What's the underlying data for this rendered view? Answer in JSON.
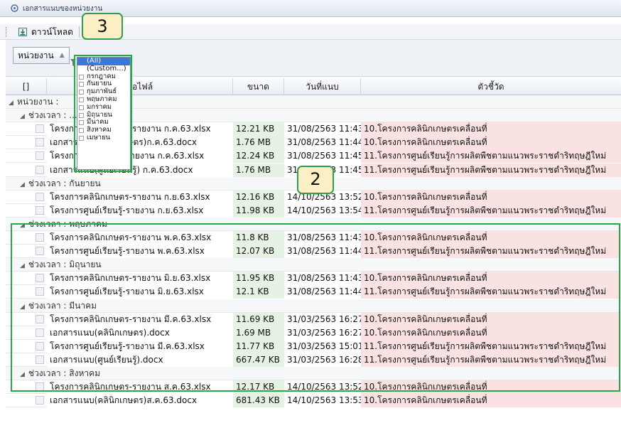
{
  "window": {
    "title": "เอกสารแนบของหน่วยงาน"
  },
  "toolbar": {
    "download_label": "ดาวน์โหลด"
  },
  "group_panel": {
    "chip_label": "หน่วยงาน"
  },
  "grid": {
    "columns": {
      "select": "[]",
      "file_name": "ชื่อไฟล์",
      "size": "ขนาด",
      "date": "วันที่แนบ",
      "indicator": "ตัวชี้วัด"
    },
    "org_group_label": "หน่วยงาน : ",
    "rows": [
      {
        "kind": "group",
        "label": "ช่วงเวลา : ..."
      },
      {
        "kind": "data",
        "name": "โครงการคลินิกเกษตร-รายงาน ก.ค.63.xlsx",
        "size": "12.21 KB",
        "date": "31/08/2563 11:43",
        "indicator": "10.โครงการคลินิกเกษตรเคลื่อนที่"
      },
      {
        "kind": "data",
        "name": "เอกสารแนบ(คลินิกเกษตร)ก.ค.63.docx",
        "size": "1.76 MB",
        "date": "31/08/2563 11:44",
        "indicator": "10.โครงการคลินิกเกษตรเคลื่อนที่"
      },
      {
        "kind": "data",
        "name": "โครงการศูนย์เรียนรู้-รายงาน ก.ค.63.xlsx",
        "size": "12.24 KB",
        "date": "31/08/2563 11:45",
        "indicator": "11.โครงการศูนย์เรียนรู้การผลิตพืชตามแนวพระราชดำริทฤษฎีใหม่"
      },
      {
        "kind": "data",
        "name": "เอกสารแนบ(ศูนย์เรียนรู้) ก.ค.63.docx",
        "size": "1.76 MB",
        "date": "31/08/2563 11:45",
        "indicator": "11.โครงการศูนย์เรียนรู้การผลิตพืชตามแนวพระราชดำริทฤษฎีใหม่"
      },
      {
        "kind": "group",
        "label": "ช่วงเวลา : กันยายน"
      },
      {
        "kind": "data",
        "name": "โครงการคลินิกเกษตร-รายงาน ก.ย.63.xlsx",
        "size": "12.16 KB",
        "date": "14/10/2563 13:52",
        "indicator": "10.โครงการคลินิกเกษตรเคลื่อนที่"
      },
      {
        "kind": "data",
        "name": "โครงการศูนย์เรียนรู้-รายงาน ก.ย.63.xlsx",
        "size": "11.98 KB",
        "date": "14/10/2563 13:54",
        "indicator": "11.โครงการศูนย์เรียนรู้การผลิตพืชตามแนวพระราชดำริทฤษฎีใหม่"
      },
      {
        "kind": "group",
        "label": "ช่วงเวลา : พฤษภาคม"
      },
      {
        "kind": "data",
        "name": "โครงการคลินิกเกษตร-รายงาน พ.ค.63.xlsx",
        "size": "11.8 KB",
        "date": "31/08/2563 11:43",
        "indicator": "10.โครงการคลินิกเกษตรเคลื่อนที่"
      },
      {
        "kind": "data",
        "name": "โครงการศูนย์เรียนรู้-รายงาน พ.ค.63.xlsx",
        "size": "12.07 KB",
        "date": "31/08/2563 11:44",
        "indicator": "11.โครงการศูนย์เรียนรู้การผลิตพืชตามแนวพระราชดำริทฤษฎีใหม่"
      },
      {
        "kind": "group",
        "label": "ช่วงเวลา : มิถุนายน"
      },
      {
        "kind": "data",
        "name": "โครงการคลินิกเกษตร-รายงาน มิ.ย.63.xlsx",
        "size": "11.95 KB",
        "date": "31/08/2563 11:43",
        "indicator": "10.โครงการคลินิกเกษตรเคลื่อนที่"
      },
      {
        "kind": "data",
        "name": "โครงการศูนย์เรียนรู้-รายงาน มิ.ย.63.xlsx",
        "size": "12.1 KB",
        "date": "31/08/2563 11:44",
        "indicator": "11.โครงการศูนย์เรียนรู้การผลิตพืชตามแนวพระราชดำริทฤษฎีใหม่"
      },
      {
        "kind": "group",
        "label": "ช่วงเวลา : มีนาคม"
      },
      {
        "kind": "data",
        "name": "โครงการคลินิกเกษตร-รายงาน มี.ค.63.xlsx",
        "size": "11.69 KB",
        "date": "31/03/2563 16:27",
        "indicator": "10.โครงการคลินิกเกษตรเคลื่อนที่"
      },
      {
        "kind": "data",
        "name": "เอกสารแนบ(คลินิกเกษตร).docx",
        "size": "1.69 MB",
        "date": "31/03/2563 16:27",
        "indicator": "10.โครงการคลินิกเกษตรเคลื่อนที่"
      },
      {
        "kind": "data",
        "name": "โครงการศูนย์เรียนรู้-รายงาน มี.ค.63.xlsx",
        "size": "11.77 KB",
        "date": "31/03/2563 15:01",
        "indicator": "11.โครงการศูนย์เรียนรู้การผลิตพืชตามแนวพระราชดำริทฤษฎีใหม่"
      },
      {
        "kind": "data",
        "name": "เอกสารแนบ(ศูนย์เรียนรู้).docx",
        "size": "667.47 KB",
        "date": "31/03/2563 16:28",
        "indicator": "11.โครงการศูนย์เรียนรู้การผลิตพืชตามแนวพระราชดำริทฤษฎีใหม่"
      },
      {
        "kind": "group",
        "label": "ช่วงเวลา : สิงหาคม"
      },
      {
        "kind": "data",
        "name": "โครงการคลินิกเกษตร-รายงาน ส.ค.63.xlsx",
        "size": "12.17 KB",
        "date": "14/10/2563 13:52",
        "indicator": "10.โครงการคลินิกเกษตรเคลื่อนที่"
      },
      {
        "kind": "data",
        "name": "เอกสารแนบ(คลินิกเกษตร)ส.ค.63.docx",
        "size": "681.43 KB",
        "date": "14/10/2563 13:53",
        "indicator": "10.โครงการคลินิกเกษตรเคลื่อนที่"
      }
    ]
  },
  "filter_dropdown": {
    "options": [
      "(All)",
      "(Custom...)",
      "กรกฎาคม",
      "กันยายน",
      "กุมภาพันธ์",
      "พฤษภาคม",
      "มกราคม",
      "มิถุนายน",
      "มีนาคม",
      "สิงหาคม",
      "เมษายน"
    ],
    "selected": "(All)"
  },
  "callouts": [
    {
      "label": "3"
    },
    {
      "label": "2"
    }
  ],
  "colors": {
    "size_cell": "#e6f2e3",
    "indicator_cell": "#fbe2e2",
    "highlight": "#27a84a",
    "callout_fill": "#fcefc6",
    "selected_option": "#3c78d8"
  },
  "icons": {
    "window": "attachment-icon",
    "download": "download-icon",
    "sort": "sort-asc-icon",
    "filter": "filter-icon",
    "expand": "expand-arrow-icon"
  }
}
